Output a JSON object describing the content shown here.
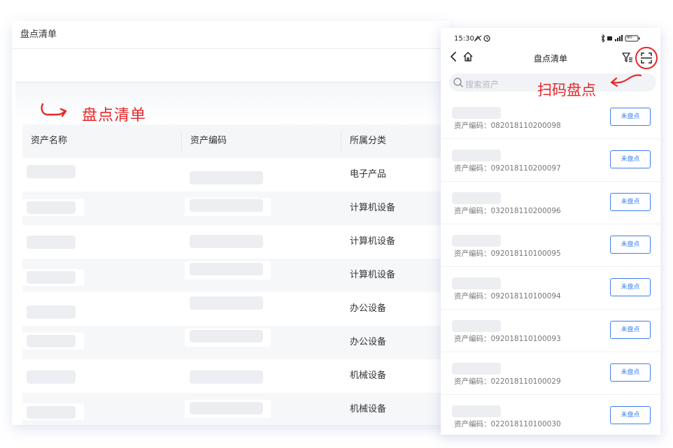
{
  "desktop": {
    "title": "盘点清单",
    "annotation": "盘点清单",
    "columns": [
      "资产名称",
      "资产编码",
      "所属分类"
    ],
    "rows": [
      {
        "category": "电子产品"
      },
      {
        "category": "计算机设备"
      },
      {
        "category": "计算机设备"
      },
      {
        "category": "计算机设备"
      },
      {
        "category": "办公设备"
      },
      {
        "category": "办公设备"
      },
      {
        "category": "机械设备"
      },
      {
        "category": "机械设备"
      }
    ]
  },
  "phone": {
    "status_time": "15:30",
    "battery": "80",
    "title": "盘点清单",
    "search_placeholder": "搜索资产",
    "scan_annotation": "扫码盘点",
    "code_label": "资产编码：",
    "button_label": "未盘点",
    "items": [
      {
        "code": "082018110200098"
      },
      {
        "code": "092018110200097"
      },
      {
        "code": "032018110200096"
      },
      {
        "code": "092018110100095"
      },
      {
        "code": "092018110100094"
      },
      {
        "code": "092018110100093"
      },
      {
        "code": "022018110100029"
      },
      {
        "code": "022018110100030"
      }
    ]
  },
  "colors": {
    "annotation": "#e8262a",
    "accent": "#3d7ff0"
  }
}
